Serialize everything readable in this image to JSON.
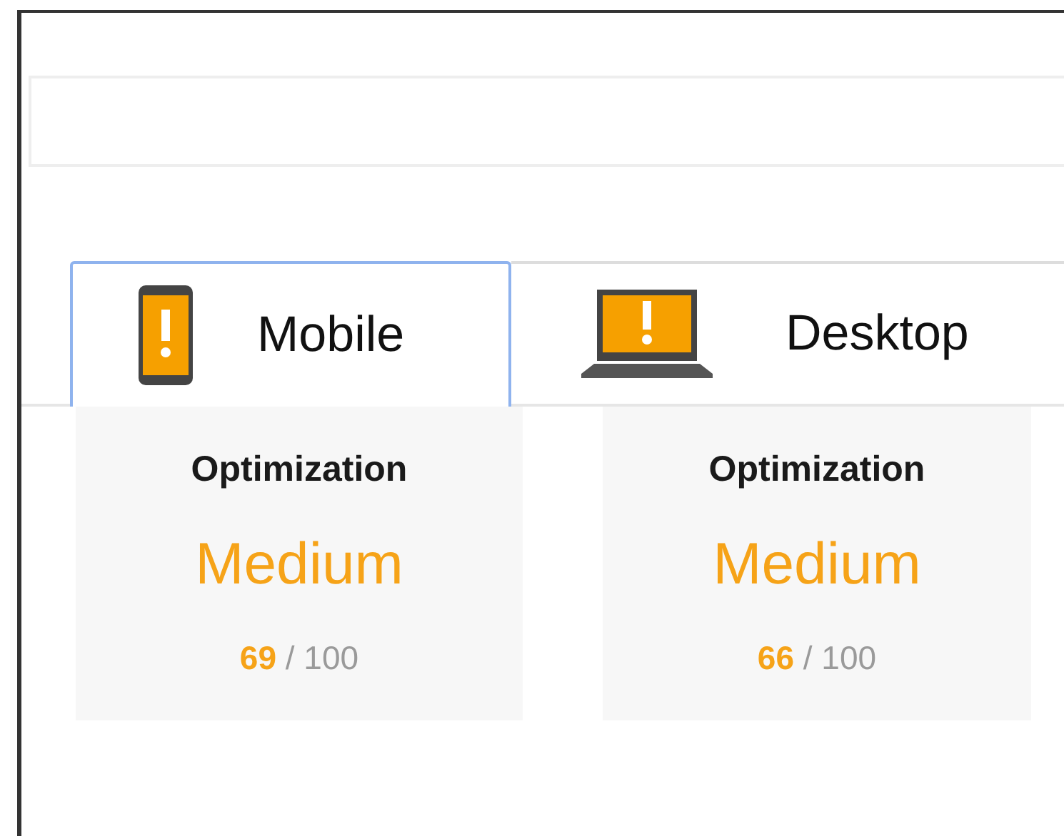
{
  "tabs": [
    {
      "kind": "mobile",
      "label": "Mobile",
      "selected": true
    },
    {
      "kind": "desktop",
      "label": "Desktop",
      "selected": false
    }
  ],
  "cards": [
    {
      "title": "Optimization",
      "rating": "Medium",
      "score": "69",
      "max": "/ 100"
    },
    {
      "title": "Optimization",
      "rating": "Medium",
      "score": "66",
      "max": "/ 100"
    }
  ]
}
